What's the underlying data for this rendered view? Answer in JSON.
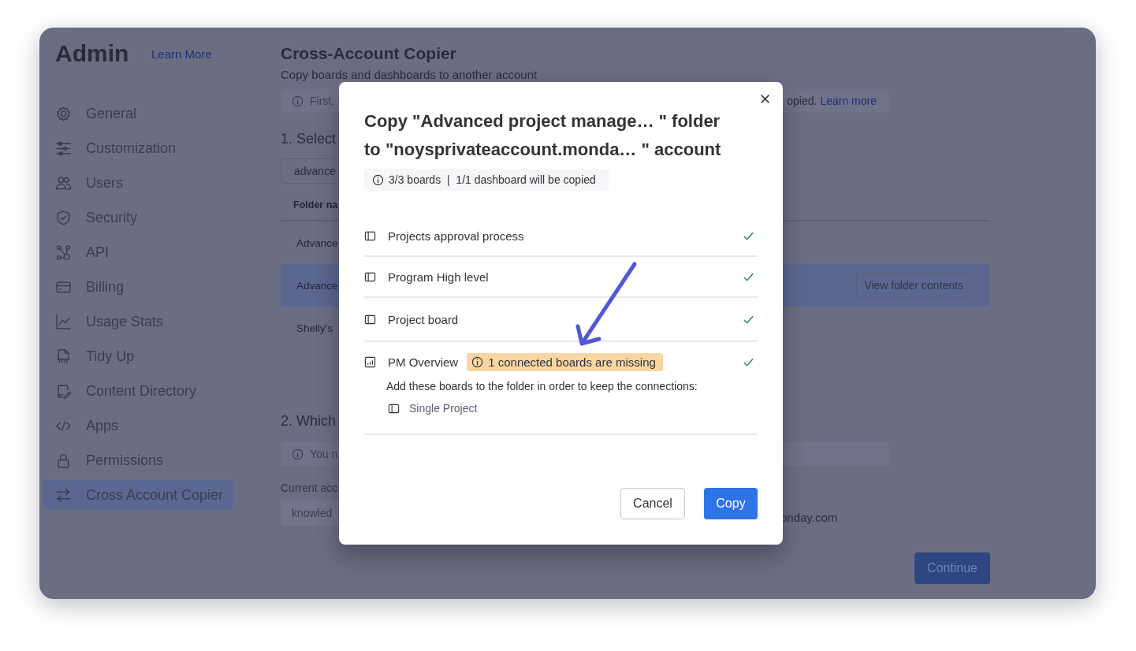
{
  "sidebar": {
    "title": "Admin",
    "link": "Learn More",
    "items": [
      {
        "label": "General",
        "selected": false
      },
      {
        "label": "Customization",
        "selected": false
      },
      {
        "label": "Users",
        "selected": false
      },
      {
        "label": "Security",
        "selected": false
      },
      {
        "label": "API",
        "selected": false
      },
      {
        "label": "Billing",
        "selected": false
      },
      {
        "label": "Usage Stats",
        "selected": false
      },
      {
        "label": "Tidy Up",
        "selected": false
      },
      {
        "label": "Content Directory",
        "selected": false
      },
      {
        "label": "Apps",
        "selected": false
      },
      {
        "label": "Permissions",
        "selected": false
      },
      {
        "label": "Cross Account Copier",
        "selected": true
      }
    ]
  },
  "page": {
    "title": "Cross-Account Copier",
    "subtitle": "Copy boards and dashboards to another account",
    "info_banner": {
      "text_start": "First,",
      "text_end": "opied.",
      "link": "Learn more"
    },
    "step_1_heading": "1. Select",
    "search": {
      "value": "advance"
    },
    "table": {
      "column_1": "Folder na",
      "rows": [
        {
          "cell": "Advance",
          "selected": false
        },
        {
          "cell": "Advance",
          "selected": true,
          "action": "View folder contents"
        },
        {
          "cell": "Shelly's",
          "selected": false
        }
      ]
    },
    "step_2_heading": "2. Which",
    "info_banner_2": "You n",
    "current_account_label": "Current acc",
    "current_account_value": "knowled",
    "target_account_fragment": "onday.com",
    "continue_button": "Continue"
  },
  "modal": {
    "title_lines": [
      "Copy \"Advanced project manage… \" folder",
      "to \"noysprivateaccount.monda… \" account"
    ],
    "summary": "3/3 boards  |  1/1 dashboard will be copied",
    "items": [
      {
        "name": "Projects approval process",
        "kind": "board",
        "done": true
      },
      {
        "name": "Program High level",
        "kind": "board",
        "done": true
      },
      {
        "name": "Project board",
        "kind": "board",
        "done": true
      },
      {
        "name": "PM Overview",
        "kind": "dashboard",
        "done": true,
        "warning": "1 connected boards are missing",
        "note": "Add these boards to the folder in order to keep the connections:",
        "missing": [
          {
            "name": "Single Project",
            "kind": "board"
          }
        ]
      }
    ],
    "buttons": {
      "cancel": "Cancel",
      "confirm": "Copy"
    }
  }
}
